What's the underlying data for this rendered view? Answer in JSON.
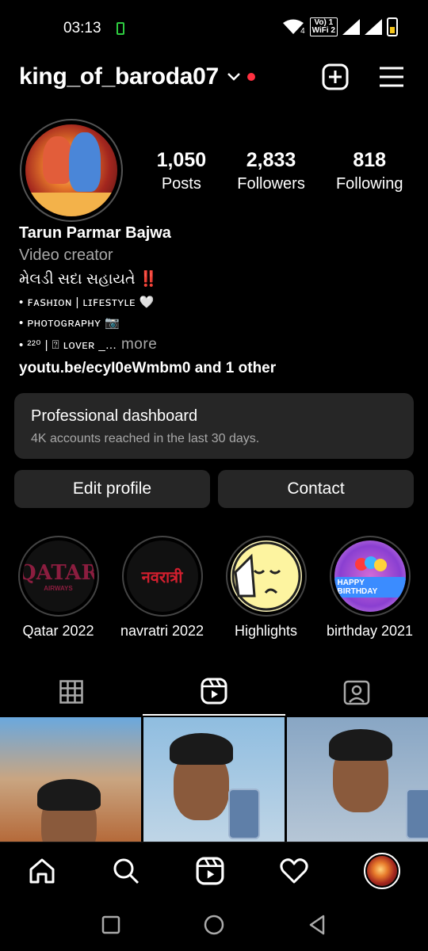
{
  "status_bar": {
    "time": "03:13",
    "network_1": "Vo) 1",
    "network_2": "WiFi 2",
    "lte": "4"
  },
  "header": {
    "username": "king_of_baroda07"
  },
  "profile": {
    "posts_count": "1,050",
    "posts_label": "Posts",
    "followers_count": "2,833",
    "followers_label": "Followers",
    "following_count": "818",
    "following_label": "Following"
  },
  "bio": {
    "name": "Tarun Parmar Bajwa",
    "category": "Video creator",
    "line1": "મેલડી સદા સહાયતે ‼️",
    "line2": "• ꜰᴀꜱʜɪᴏɴ | ʟɪꜰᴇꜱᴛʏʟᴇ 🤍",
    "line3": "• ᴘʜᴏᴛᴏɢʀᴀᴘʜʏ 📷",
    "line4": "• ²²⁰ | ⍰ ʟᴏᴠᴇʀ _...",
    "more": " more",
    "link": "youtu.be/ecyI0eWmbm0 and 1 other"
  },
  "dashboard": {
    "title": "Professional dashboard",
    "subtitle": "4K accounts reached in the last 30 days."
  },
  "buttons": {
    "edit": "Edit profile",
    "contact": "Contact"
  },
  "highlights": [
    {
      "label": "Qatar 2022",
      "art": "QATAR",
      "art_sub": "AIRWAYS"
    },
    {
      "label": "navratri 2022",
      "art": "नवरात्री"
    },
    {
      "label": "Highlights"
    },
    {
      "label": "birthday 2021",
      "art": "HAPPY BIRTHDAY"
    }
  ],
  "icons": {
    "header": [
      "chevron-down-icon",
      "new-post-icon",
      "menu-icon"
    ],
    "tabs": [
      "grid-icon",
      "reels-icon",
      "tagged-icon"
    ],
    "bottom_nav": [
      "home-icon",
      "search-icon",
      "reels-icon",
      "heart-icon",
      "profile-avatar"
    ],
    "android_nav": [
      "recents-icon",
      "home-circle-icon",
      "back-icon"
    ]
  },
  "colors": {
    "background": "#000000",
    "card": "#262626",
    "notification_dot": "#ff3040",
    "muted_text": "#a8a8a8"
  }
}
